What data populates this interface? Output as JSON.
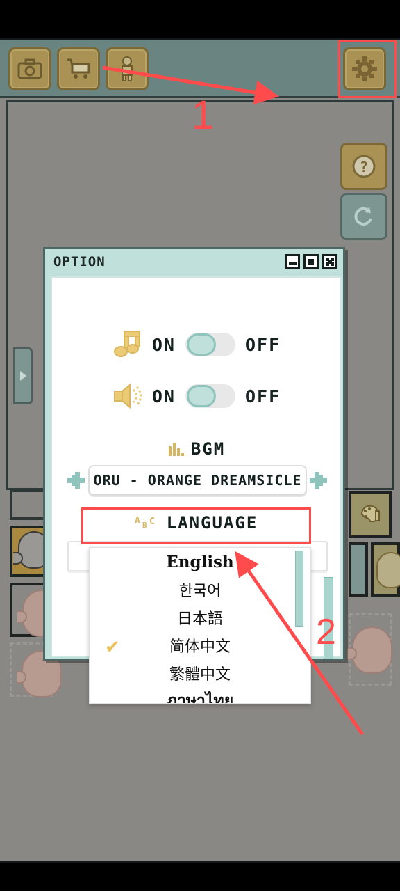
{
  "toolbar": {
    "buttons": [
      {
        "name": "camera-button",
        "icon": "camera-icon"
      },
      {
        "name": "shop-button",
        "icon": "shopping-cart-icon"
      },
      {
        "name": "character-button",
        "icon": "person-icon"
      },
      {
        "name": "settings-button",
        "icon": "gear-icon"
      }
    ]
  },
  "side_buttons": {
    "help": {
      "label": "?",
      "icon": "question-mark-icon"
    },
    "undo": {
      "icon": "undo-arrow-icon"
    }
  },
  "annotations": [
    {
      "id": "1",
      "label": "1",
      "target": "settings-button"
    },
    {
      "id": "2",
      "label": "2",
      "target": "language-dropdown"
    }
  ],
  "option_window": {
    "title": "OPTION",
    "window_buttons": [
      {
        "name": "minimize-button",
        "glyph": "_"
      },
      {
        "name": "maximize-button",
        "glyph": "□"
      },
      {
        "name": "close-button",
        "glyph": "✕"
      }
    ],
    "rows": [
      {
        "icon": "music-note-icon",
        "on_label": "ON",
        "off_label": "OFF",
        "state": "ON"
      },
      {
        "icon": "speaker-icon",
        "on_label": "ON",
        "off_label": "OFF",
        "state": "ON"
      }
    ],
    "bgm": {
      "icon": "equalizer-bars-icon",
      "heading": "BGM",
      "track": "ORU - ORANGE DREAMSICLE",
      "prev_arrow": "left-arrow-icon",
      "next_arrow": "right-arrow-icon"
    },
    "language": {
      "icon": "abc-icon",
      "heading": "LANGUAGE",
      "selected": "简体中文",
      "options": [
        {
          "label": "English",
          "checked": false,
          "style": "serif"
        },
        {
          "label": "한국어",
          "checked": false,
          "style": "sans"
        },
        {
          "label": "日本語",
          "checked": false,
          "style": "sans"
        },
        {
          "label": "简体中文",
          "checked": true,
          "style": "sans"
        },
        {
          "label": "繁體中文",
          "checked": false,
          "style": "sans"
        },
        {
          "label": "ภาษาไทย",
          "checked": false,
          "style": "serif"
        }
      ],
      "check_glyph": "✔"
    }
  },
  "colors": {
    "accent_teal": "#bfe0db",
    "toolbar": "#6a8482",
    "button_gold": "#a99254",
    "annotation_red": "#ff4b4b",
    "play_bg": "#8a8884",
    "check_yellow": "#e9c35e"
  }
}
